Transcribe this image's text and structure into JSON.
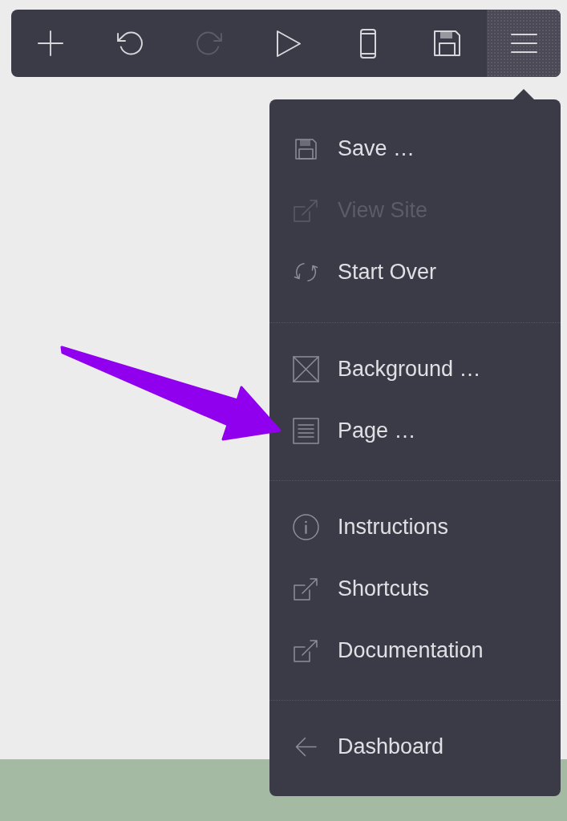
{
  "toolbar": {
    "buttons": [
      {
        "kind": "add",
        "disabled": false,
        "selected": false
      },
      {
        "kind": "undo",
        "disabled": false,
        "selected": false
      },
      {
        "kind": "redo",
        "disabled": true,
        "selected": false
      },
      {
        "kind": "preview",
        "disabled": false,
        "selected": false
      },
      {
        "kind": "device",
        "disabled": false,
        "selected": false
      },
      {
        "kind": "save",
        "disabled": false,
        "selected": false
      },
      {
        "kind": "menu",
        "disabled": false,
        "selected": true
      }
    ]
  },
  "menu": {
    "sections": [
      {
        "items": [
          {
            "kind": "save",
            "label": "Save …",
            "disabled": false
          },
          {
            "kind": "external",
            "label": "View Site",
            "disabled": true
          },
          {
            "kind": "sync",
            "label": "Start Over",
            "disabled": false
          }
        ]
      },
      {
        "items": [
          {
            "kind": "image",
            "label": "Background …",
            "disabled": false
          },
          {
            "kind": "page",
            "label": "Page …",
            "disabled": false
          }
        ]
      },
      {
        "items": [
          {
            "kind": "info",
            "label": "Instructions",
            "disabled": false
          },
          {
            "kind": "external",
            "label": "Shortcuts",
            "disabled": false
          },
          {
            "kind": "external",
            "label": "Documentation",
            "disabled": false
          }
        ]
      },
      {
        "items": [
          {
            "kind": "back",
            "label": "Dashboard",
            "disabled": false
          }
        ]
      }
    ]
  },
  "annotations": [
    {
      "kind": "arrow"
    }
  ]
}
